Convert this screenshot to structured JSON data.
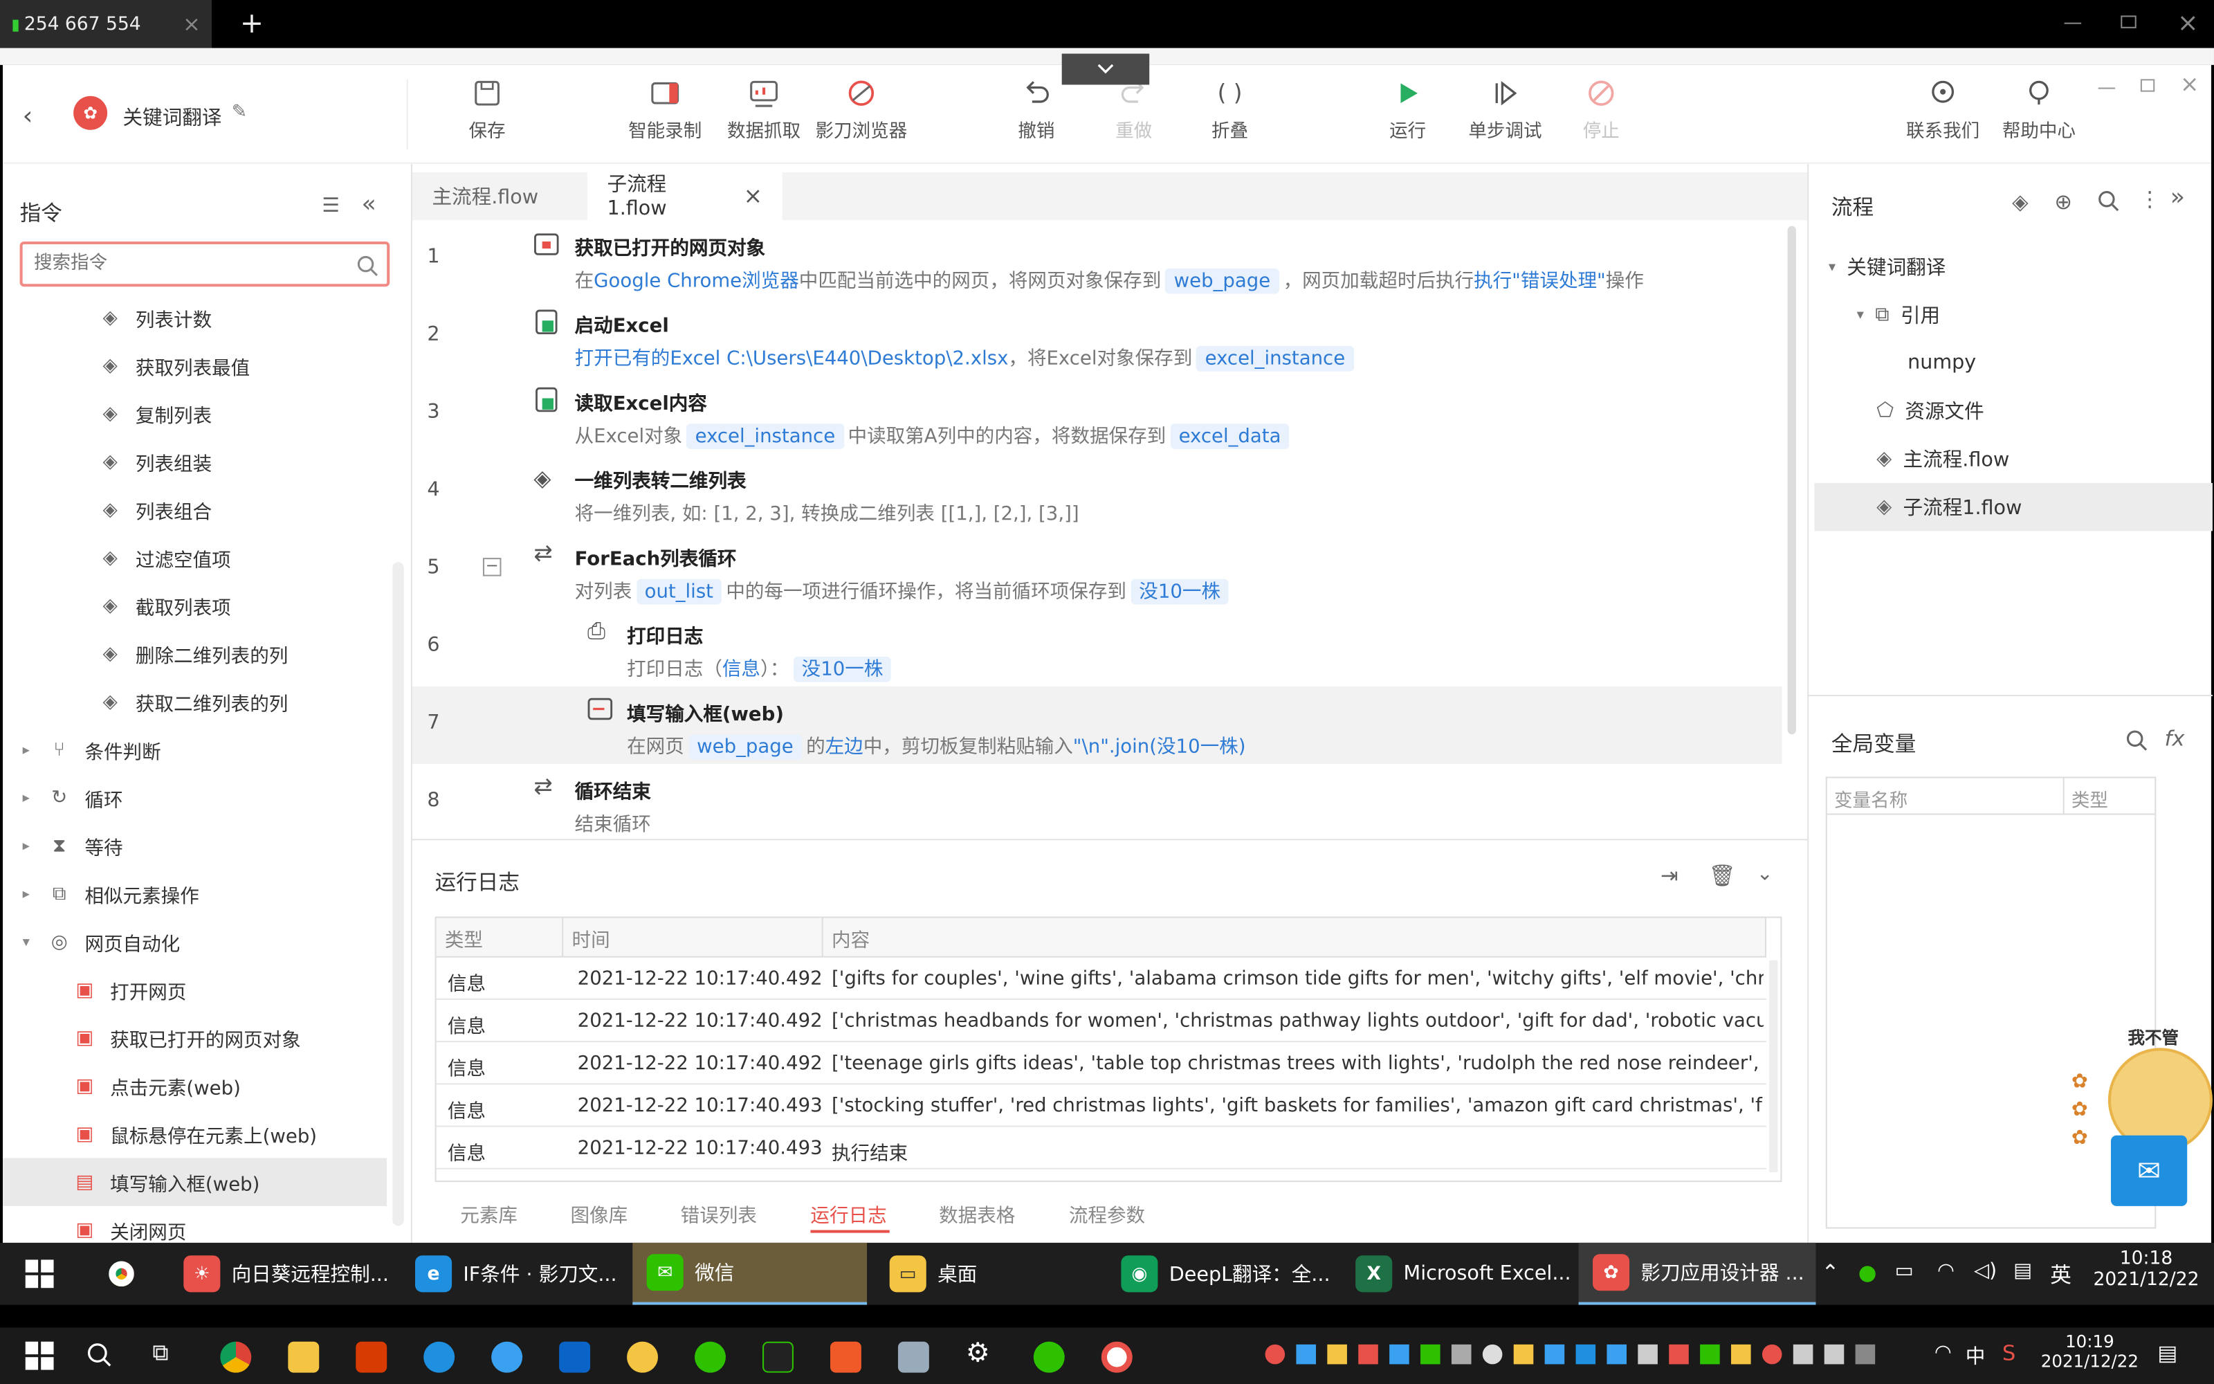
{
  "remote": {
    "tab_title": "254 667 554",
    "close": "×",
    "add": "+"
  },
  "app": {
    "title": "关键词翻译"
  },
  "toolbar": {
    "save": "保存",
    "record": "智能录制",
    "scrape": "数据抓取",
    "browser": "影刀浏览器",
    "undo": "撤销",
    "redo": "重做",
    "fold": "折叠",
    "run": "运行",
    "step": "单步调试",
    "stop": "停止",
    "contact": "联系我们",
    "help": "帮助中心"
  },
  "left": {
    "title": "指令",
    "search_placeholder": "搜索指令",
    "items": [
      "列表计数",
      "获取列表最值",
      "复制列表",
      "列表组装",
      "列表组合",
      "过滤空值项",
      "截取列表项",
      "删除二维列表的列",
      "获取二维列表的列"
    ],
    "groups": [
      "条件判断",
      "循环",
      "等待",
      "相似元素操作",
      "网页自动化"
    ],
    "web_items": [
      "打开网页",
      "获取已打开的网页对象",
      "点击元素(web)",
      "鼠标悬停在元素上(web)",
      "填写输入框(web)",
      "关闭网页"
    ]
  },
  "tabs": {
    "main": "主流程.flow",
    "sub": "子流程1.flow",
    "close": "×"
  },
  "steps": [
    {
      "n": "1",
      "title": "获取已打开的网页对象",
      "d1": "在",
      "d2": "Google Chrome浏览器",
      "d3": "中匹配当前选中的网页，将网页对象保存到",
      "v1": "web_page",
      "d4": "，网页加载超时后执行",
      "d5": "执行\"错误处理\"",
      "d6": "操作"
    },
    {
      "n": "2",
      "title": "启动Excel",
      "d1": "打开已有的Excel C:\\Users\\E440\\Desktop\\2.xlsx",
      "d2": "，将Excel对象保存到",
      "v1": "excel_instance"
    },
    {
      "n": "3",
      "title": "读取Excel内容",
      "d1": "从Excel对象",
      "v1": "excel_instance",
      "d2": "中读取第A列中的内容，将数据保存到",
      "v2": "excel_data"
    },
    {
      "n": "4",
      "title": "一维列表转二维列表",
      "d1": "将一维列表, 如: [1, 2, 3], 转换成二维列表 [[1,], [2,], [3,]]"
    },
    {
      "n": "5",
      "title": "ForEach列表循环",
      "d1": "对列表",
      "v1": "out_list",
      "d2": "中的每一项进行循环操作，将当前循环项保存到",
      "v2": "没10一株"
    },
    {
      "n": "6",
      "title": "打印日志",
      "d1": "打印日志（",
      "d2": "信息",
      "d3": "）：",
      "v1": "没10一株"
    },
    {
      "n": "7",
      "title": "填写输入框(web)",
      "d1": "在网页",
      "v1": "web_page",
      "d2": "的",
      "d3": "左边",
      "d4": "中，剪切板复制粘贴输入",
      "d5": "\"\\n\".join(没10一株)"
    },
    {
      "n": "8",
      "title": "循环结束",
      "d1": "结束循环"
    }
  ],
  "log": {
    "title": "运行日志",
    "headers": [
      "类型",
      "时间",
      "内容"
    ],
    "rows": [
      [
        "信息",
        "2021-12-22 10:17:40.492",
        "['gifts for couples', 'wine gifts', 'alabama crimson tide gifts for men', 'witchy gifts', 'elf movie', 'christi"
      ],
      [
        "信息",
        "2021-12-22 10:17:40.492",
        "['christmas headbands for women', 'christmas pathway lights outdoor', 'gift for dad', 'robotic vacuu"
      ],
      [
        "信息",
        "2021-12-22 10:17:40.492",
        "['teenage girls gifts ideas', 'table top christmas trees with lights', 'rudolph the red nose reindeer', 'fo"
      ],
      [
        "信息",
        "2021-12-22 10:17:40.493",
        "['stocking stuffer', 'red christmas lights', 'gift baskets for families', 'amazon gift card christmas', 'fros"
      ],
      [
        "信息",
        "2021-12-22 10:17:40.493",
        "执行结束"
      ]
    ],
    "bottom_tabs": [
      "元素库",
      "图像库",
      "错误列表",
      "运行日志",
      "数据表格",
      "流程参数"
    ]
  },
  "right": {
    "title": "流程",
    "tree": [
      "关键词翻译",
      "引用",
      "numpy",
      "资源文件",
      "主流程.flow",
      "子流程1.flow"
    ],
    "globals_title": "全局变量",
    "var_headers": [
      "变量名称",
      "类型"
    ],
    "mascot": "我不管"
  },
  "taskbar1": {
    "items": [
      "向日葵远程控制...",
      "IF条件 · 影刀文...",
      "微信",
      "桌面",
      "DeepL翻译：全...",
      "Microsoft Excel...",
      "影刀应用设计器 ..."
    ],
    "ime": "英",
    "time": "10:18",
    "date": "2021/12/22"
  },
  "taskbar2": {
    "ime": "中",
    "time": "10:19",
    "date": "2021/12/22"
  },
  "colors": {
    "accent": "#e8504a",
    "blue": "#2e7bd6",
    "run": "#27ae60"
  }
}
